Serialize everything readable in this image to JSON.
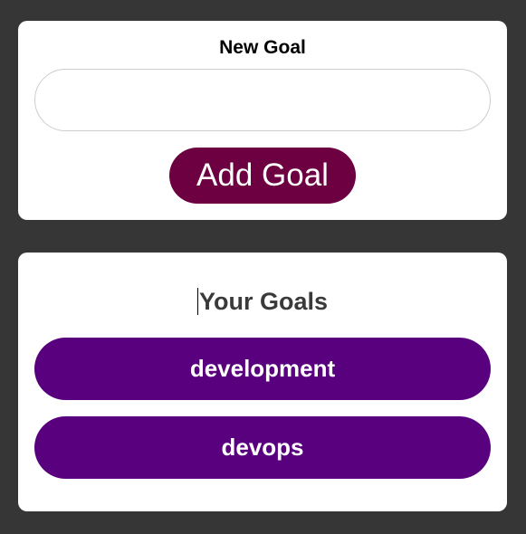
{
  "new_goal": {
    "label": "New Goal",
    "input_value": "",
    "button_label": "Add Goal"
  },
  "goals": {
    "title": "Your Goals",
    "items": [
      {
        "label": "development"
      },
      {
        "label": "devops"
      }
    ]
  },
  "colors": {
    "background": "#363636",
    "card": "#ffffff",
    "add_button": "#6c0040",
    "goal_item": "#58007e"
  }
}
